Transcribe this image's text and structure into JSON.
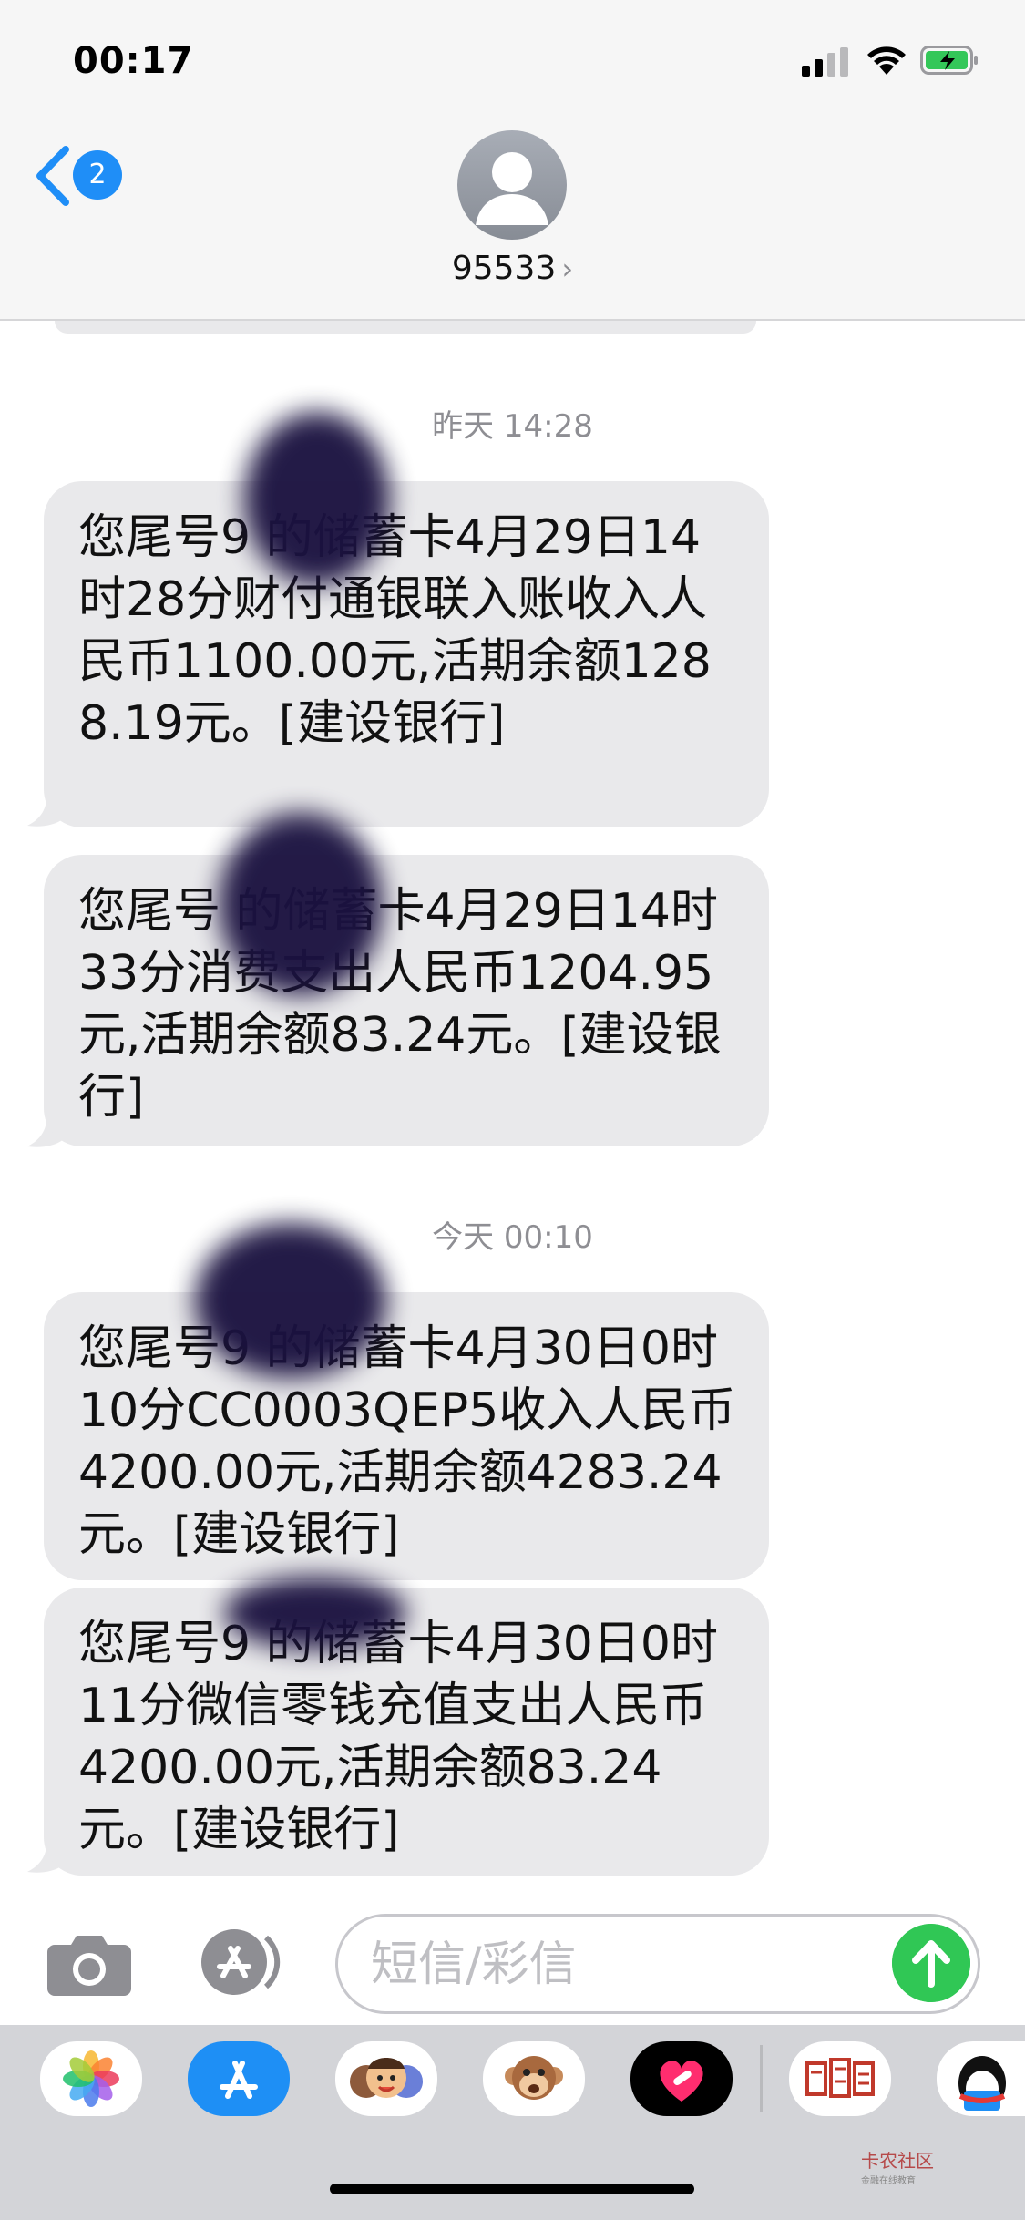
{
  "status_bar": {
    "time": "00:17"
  },
  "header": {
    "back_badge": "2",
    "contact_name": "95533",
    "contact_chevron": "›"
  },
  "messages": [
    {
      "timestamp": "昨天 14:28",
      "text": "您尾号9  的储蓄卡4月29日14时28分财付通银联入账收入人民币1100.00元,活期余额1288.19元。[建设银行]"
    },
    {
      "text": "您尾号  的储蓄卡4月29日14时33分消费支出人民币1204.95元,活期余额83.24元。[建设银行]"
    },
    {
      "timestamp": "今天 00:10",
      "text": "您尾号9  的储蓄卡4月30日0时10分CC0003QEP5收入人民币4200.00元,活期余额4283.24元。[建设银行]"
    },
    {
      "text": "您尾号9  的储蓄卡4月30日0时11分微信零钱充值支出人民币4200.00元,活期余额83.24元。[建设银行]"
    }
  ],
  "input_bar": {
    "placeholder": "短信/彩信"
  },
  "app_tray": {
    "items": [
      "photos-app",
      "app-store-app",
      "memoji-stickers",
      "animoji-monkey",
      "digital-touch",
      "calendar-stamp-app",
      "qq-app"
    ]
  },
  "watermark": {
    "title": "卡农社区",
    "subtitle": "金融在线教育"
  },
  "colors": {
    "bubble": "#e9e9eb",
    "accent_blue": "#1f8ef7",
    "send_green": "#30c755",
    "tray": "#d3d4d8"
  }
}
